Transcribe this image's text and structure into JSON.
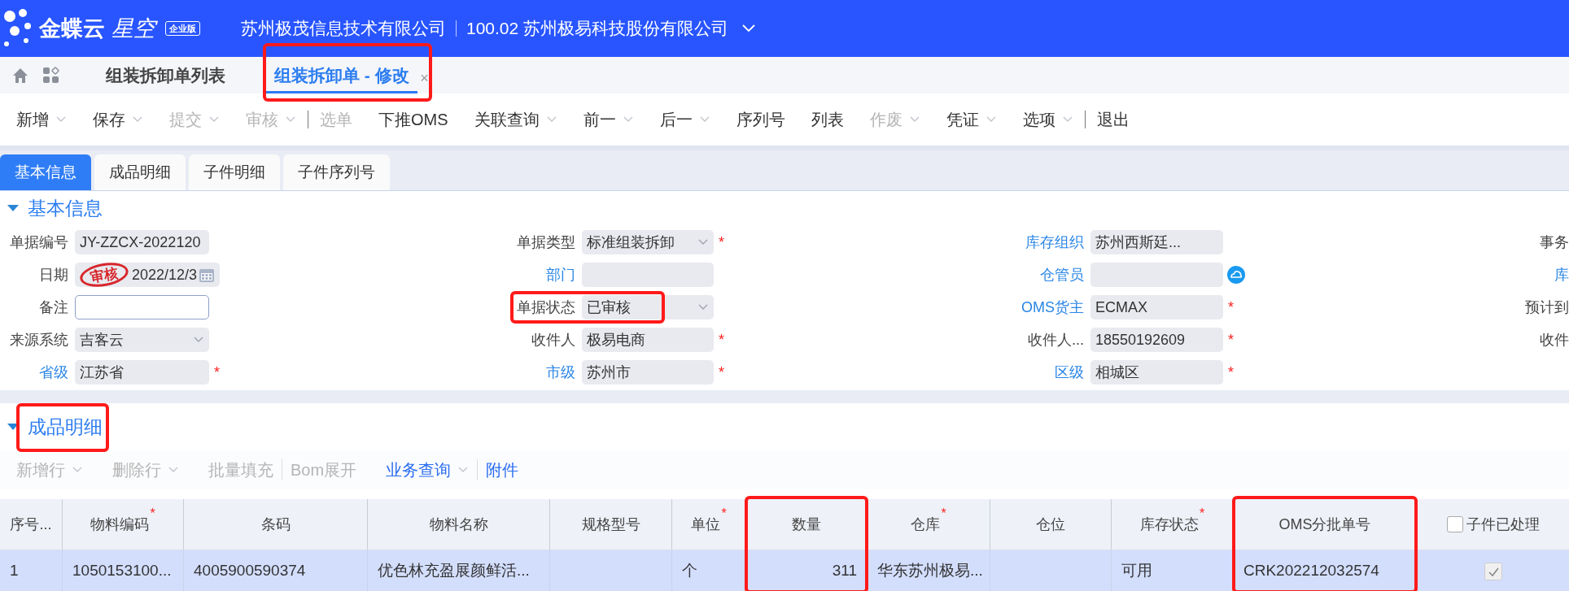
{
  "header": {
    "brand": "金蝶云",
    "product": "星空",
    "edition": "企业版",
    "org": "苏州极茂信息技术有限公司",
    "account": "100.02 苏州极易科技股份有限公司"
  },
  "page_tabs": [
    {
      "label": "组装拆卸单列表",
      "selected": false,
      "highlighted": false
    },
    {
      "label": "组装拆卸单 - 修改",
      "selected": true,
      "close": "×",
      "highlighted": true
    }
  ],
  "toolbar": [
    {
      "label": "新增",
      "disabled": false,
      "caret": true
    },
    {
      "label": "保存",
      "disabled": false,
      "caret": true
    },
    {
      "label": "提交",
      "disabled": true,
      "caret": true
    },
    {
      "label": "审核",
      "disabled": true,
      "caret": true,
      "separator": true
    },
    {
      "label": "选单",
      "disabled": true,
      "caret": false
    },
    {
      "label": "下推OMS",
      "disabled": false,
      "caret": false
    },
    {
      "label": "关联查询",
      "disabled": false,
      "caret": true
    },
    {
      "label": "前一",
      "disabled": false,
      "caret": true
    },
    {
      "label": "后一",
      "disabled": false,
      "caret": true
    },
    {
      "label": "序列号",
      "disabled": false,
      "caret": false
    },
    {
      "label": "列表",
      "disabled": false,
      "caret": false
    },
    {
      "label": "作废",
      "disabled": true,
      "caret": true
    },
    {
      "label": "凭证",
      "disabled": false,
      "caret": true
    },
    {
      "label": "选项",
      "disabled": false,
      "caret": true,
      "separator": true
    },
    {
      "label": "退出",
      "disabled": false,
      "caret": false
    }
  ],
  "section_tabs": [
    {
      "label": "基本信息",
      "selected": true
    },
    {
      "label": "成品明细",
      "selected": false
    },
    {
      "label": "子件明细",
      "selected": false
    },
    {
      "label": "子件序列号",
      "selected": false
    }
  ],
  "basic_info": {
    "title": "基本信息",
    "expanded": true,
    "stamp": "审核",
    "rows": [
      [
        {
          "label": "单据编号",
          "link": false,
          "kind": "text",
          "value": "JY-ZZCX-2022120"
        },
        {
          "label": "单据类型",
          "link": false,
          "kind": "dropdown",
          "value": "标准组装拆卸",
          "required": "*"
        },
        {
          "label": "库存组织",
          "link": true,
          "kind": "text",
          "value": "苏州西斯廷..."
        },
        {
          "label": "事务",
          "link": false,
          "kind": "label"
        }
      ],
      [
        {
          "label": "日期",
          "link": false,
          "kind": "date",
          "value": "2022/12/3",
          "stamped": true
        },
        {
          "label": "部门",
          "link": true,
          "kind": "text"
        },
        {
          "label": "仓管员",
          "link": true,
          "kind": "lookup"
        },
        {
          "label": "库",
          "link": true,
          "kind": "label"
        }
      ],
      [
        {
          "label": "备注",
          "link": false,
          "kind": "input"
        },
        {
          "label": "单据状态",
          "link": false,
          "kind": "dropdown",
          "value": "已审核",
          "highlighted": true
        },
        {
          "label": "OMS货主",
          "link": true,
          "kind": "text",
          "value": "ECMAX",
          "required": "*"
        },
        {
          "label": "预计到",
          "link": false,
          "kind": "label"
        }
      ],
      [
        {
          "label": "来源系统",
          "link": false,
          "kind": "dropdown",
          "value": "吉客云"
        },
        {
          "label": "收件人",
          "link": false,
          "kind": "text",
          "value": "极易电商",
          "required": "*"
        },
        {
          "label": "收件人...",
          "link": false,
          "kind": "text",
          "value": "18550192609",
          "required": "*"
        },
        {
          "label": "收件",
          "link": false,
          "kind": "label"
        }
      ],
      [
        {
          "label": "省级",
          "link": true,
          "kind": "text",
          "value": "江苏省",
          "required": "*"
        },
        {
          "label": "市级",
          "link": true,
          "kind": "text",
          "value": "苏州市",
          "required": "*"
        },
        {
          "label": "区级",
          "link": true,
          "kind": "text",
          "value": "相城区",
          "required": "*"
        }
      ]
    ]
  },
  "detail": {
    "title": "成品明细",
    "expanded": true,
    "highlighted": true,
    "toolbar": [
      {
        "label": "新增行",
        "disabled": true,
        "caret": true
      },
      {
        "label": "删除行",
        "disabled": true,
        "caret": true
      },
      {
        "label": "批量填充",
        "disabled": true,
        "caret": false,
        "separator": true
      },
      {
        "label": "Bom展开",
        "disabled": true,
        "caret": false
      },
      {
        "label": "业务查询",
        "disabled": false,
        "caret": true,
        "separator": true
      },
      {
        "label": "附件",
        "disabled": false,
        "caret": false
      }
    ],
    "columns": [
      {
        "label": "序号...",
        "highlighted": false
      },
      {
        "label": "物料编码",
        "required": "*",
        "highlighted": false
      },
      {
        "label": "条码",
        "highlighted": false
      },
      {
        "label": "物料名称",
        "highlighted": false
      },
      {
        "label": "规格型号",
        "highlighted": false
      },
      {
        "label": "单位",
        "required": "*",
        "highlighted": false
      },
      {
        "label": "数量",
        "highlighted": true
      },
      {
        "label": "仓库",
        "required": "*",
        "highlighted": false
      },
      {
        "label": "仓位",
        "highlighted": false
      },
      {
        "label": "库存状态",
        "required": "*",
        "highlighted": false
      },
      {
        "label": "OMS分批单号",
        "highlighted": true
      },
      {
        "label": "子件已处理",
        "highlighted": false,
        "kind": "checkbox",
        "checked": false
      }
    ],
    "rows": [
      {
        "selected": true,
        "cells": [
          "1",
          "1050153100...",
          "4005900590374",
          "优色林充盈展颜鲜活...",
          "",
          "个",
          "311",
          "华东苏州极易...",
          "",
          "可用",
          "CRK202212032574",
          {
            "kind": "checkbox",
            "checked": true
          }
        ]
      }
    ]
  }
}
